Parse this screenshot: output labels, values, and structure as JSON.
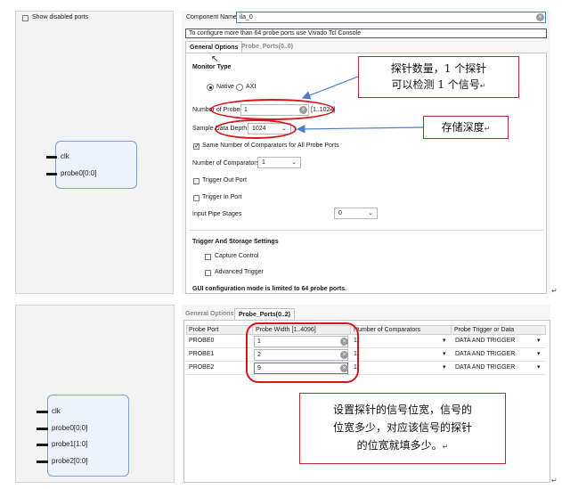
{
  "top": {
    "show_disabled_label": "Show disabled ports",
    "block_pins": [
      "clk",
      "probe0[0:0]"
    ],
    "component_name_label": "Component Name",
    "component_name_value": "ila_0",
    "info_text": "To configure more than 64 probe ports use Vivado Tcl Console",
    "tabs": [
      "General Options",
      "Probe_Ports(0..0)"
    ],
    "monitor_type_heading": "Monitor Type",
    "native_label": "Native",
    "axi_label": "AXI",
    "num_probes_label": "Number of Probes",
    "num_probes_value": "1",
    "num_probes_range": "[1..1024]",
    "sample_depth_label": "Sample Data Depth",
    "sample_depth_value": "1024",
    "same_comparators_label": "Same Number of Comparators for All Probe Ports",
    "num_comparators_label": "Number of Comparators",
    "num_comparators_value": "1",
    "trigger_out_label": "Trigger Out Port",
    "trigger_in_label": "Trigger In Port",
    "input_pipe_label": "Input Pipe Stages",
    "input_pipe_value": "0",
    "trigger_storage_heading": "Trigger And Storage Settings",
    "capture_control_label": "Capture Control",
    "advanced_trigger_label": "Advanced Trigger",
    "gui_limit_text": "GUI configuration mode is limited to 64 probe ports.",
    "callout_probes": [
      "探针数量，1 个探针",
      "可以检测 1 个信号"
    ],
    "callout_depth": "存储深度"
  },
  "bottom": {
    "tabs": [
      "General Options",
      "Probe_Ports(0..2)"
    ],
    "block_pins": [
      "clk",
      "probe0[0:0]",
      "probe1[1:0]",
      "probe2[0:0]"
    ],
    "columns": [
      "Probe Port",
      "Probe Width [1..4096]",
      "Number of Comparators",
      "Probe Trigger or Data"
    ],
    "rows": [
      {
        "port": "PROBE0",
        "width": "1",
        "comparators": "1",
        "trigger": "DATA AND TRIGGER"
      },
      {
        "port": "PROBE1",
        "width": "2",
        "comparators": "1",
        "trigger": "DATA AND TRIGGER"
      },
      {
        "port": "PROBE2",
        "width": "9",
        "comparators": "1",
        "trigger": "DATA AND TRIGGER"
      }
    ],
    "callout_lines": [
      "设置探针的信号位宽，信号的",
      "位宽多少，对应该信号的探针",
      "的位宽就填多少。"
    ]
  },
  "colors": {
    "annotation_red": "#d8141c",
    "arrow_blue": "#4a7cc9",
    "block_fill": "#eef3fb"
  }
}
